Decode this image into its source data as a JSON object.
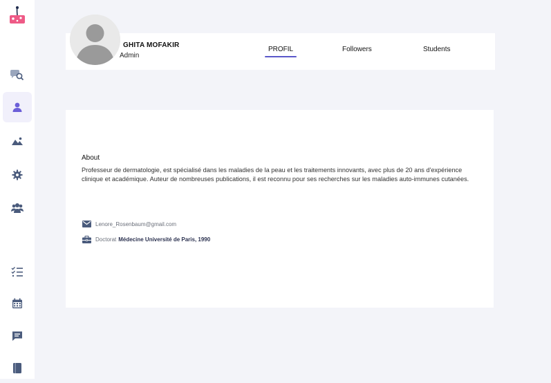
{
  "profile": {
    "name": "GHITA MOFAKIR",
    "role": "Admin"
  },
  "tabs": [
    {
      "label": "PROFIL",
      "active": true
    },
    {
      "label": "Followers",
      "active": false
    },
    {
      "label": "Students",
      "active": false
    }
  ],
  "about": {
    "title": "About",
    "text": "Professeur de dermatologie, est spécialisé dans les maladies de la peau et les traitements innovants, avec plus de 20 ans d'expérience clinique et académique. Auteur de nombreuses publications, il est reconnu pour ses recherches sur les maladies auto-immunes cutanées."
  },
  "info": {
    "email": "Lenore_Rosenbaum@gmail.com",
    "degree_label": "Doctorat",
    "degree_value": "Médecine Université de Paris, 1990"
  },
  "sidebar": {
    "items": [
      {
        "icon": "logo-icon"
      },
      {
        "icon": "chat-search-icon"
      },
      {
        "icon": "profile-icon",
        "active": true
      },
      {
        "icon": "image-icon"
      },
      {
        "icon": "settings-icon"
      },
      {
        "icon": "users-icon"
      },
      {
        "icon": "task-list-icon"
      },
      {
        "icon": "calendar-icon"
      },
      {
        "icon": "message-icon"
      },
      {
        "icon": "book-icon"
      }
    ]
  },
  "colors": {
    "accent": "#5a57c9",
    "background": "#f3f4f9",
    "sidebar_icon": "#4a5b7c",
    "active_icon": "#6c5fd8",
    "logo": "#ee5a86"
  }
}
